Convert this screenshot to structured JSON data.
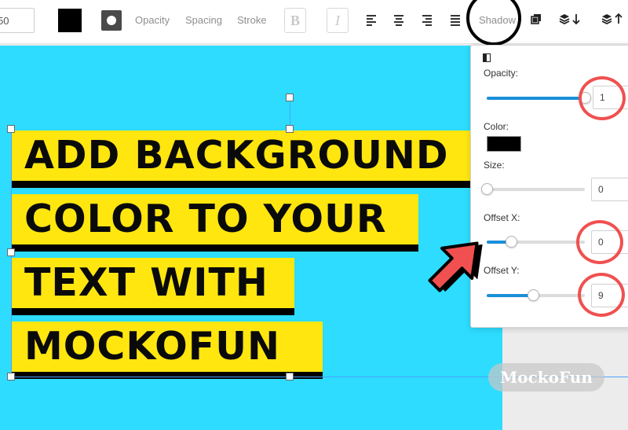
{
  "toolbar": {
    "font_size_value": "50",
    "text_color": "#000000",
    "opacity_label": "Opacity",
    "spacing_label": "Spacing",
    "stroke_label": "Stroke",
    "bold_label": "B",
    "italic_label": "I",
    "shadow_label": "Shadow",
    "icons": [
      "align-left-icon",
      "align-center-icon",
      "align-right-icon",
      "align-justify-icon",
      "duplicate-icon",
      "layer-down-icon",
      "layer-up-icon"
    ]
  },
  "canvas": {
    "background": "#2ddcff",
    "highlight_color": "#ffe60f",
    "headline_lines": [
      "ADD BACKGROUND",
      "COLOR TO YOUR",
      "TEXT WITH",
      "MOCKOFUN"
    ]
  },
  "watermark": "MockoFun",
  "shadow_panel": {
    "opacity_label": "Opacity:",
    "opacity_value": "1",
    "opacity_level": 1.0,
    "color_label": "Color:",
    "shadow_color": "#000000",
    "size_label": "Size:",
    "size_value": "0",
    "size_level": 0.0,
    "offset_x_label": "Offset X:",
    "offset_x_value": "0",
    "offset_x_level": 0.25,
    "offset_y_label": "Offset Y:",
    "offset_y_value": "9",
    "offset_y_level": 0.47
  },
  "annotation_colors": {
    "ring_red": "#f05050",
    "arrow_red": "#f05050",
    "ring_black": "#000000"
  }
}
